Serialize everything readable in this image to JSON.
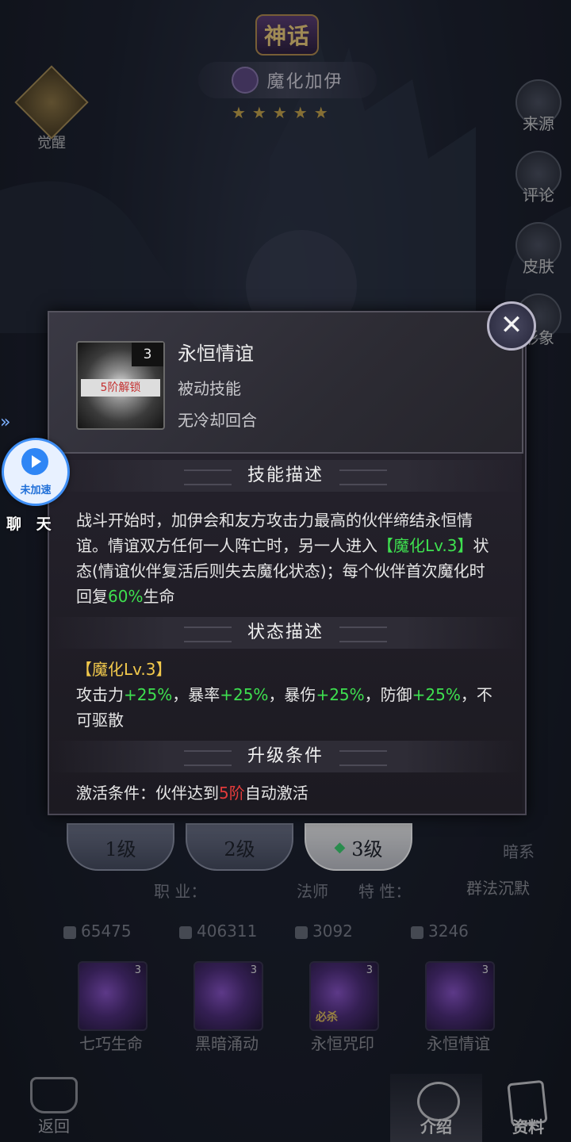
{
  "header": {
    "rarity_label": "神话",
    "hero_name": "魔化加伊",
    "stars": "★★★★★",
    "awaken_label": "觉醒"
  },
  "side_menu": [
    {
      "label": "来源"
    },
    {
      "label": "评论"
    },
    {
      "label": "皮肤"
    },
    {
      "label": "形象"
    }
  ],
  "speed_widget": {
    "label": "未加速",
    "chat_label": "聊 天"
  },
  "modal": {
    "skill_level": "3",
    "unlock_label": "5阶解锁",
    "skill_name": "永恒情谊",
    "skill_type": "被动技能",
    "cooldown": "无冷却回合",
    "close_symbol": "✕",
    "sections": {
      "skill_desc_title": "技能描述",
      "state_desc_title": "状态描述",
      "upgrade_title": "升级条件"
    },
    "skill_desc": {
      "p1": "战斗开始时，加伊会和友方攻击力最高的伙伴缔结永恒情谊。情谊双方任何一人阵亡时，另一人进入",
      "tag": "【魔化Lv.3】",
      "p2": "状态(情谊伙伴复活后则失去魔化状态)；每个伙伴首次魔化时回复",
      "pct": "60%",
      "p3": "生命"
    },
    "state_desc": {
      "tag": "【魔化Lv.3】",
      "atk_label": "攻击力",
      "atk_val": "+25%",
      "crit_label": "，暴率",
      "crit_val": "+25%",
      "critdmg_label": "，暴伤",
      "critdmg_val": "+25%",
      "def_label": "，防御",
      "def_val": "+25%",
      "tail": "，不可驱散"
    },
    "upgrade": {
      "prefix": "激活条件：伙伴达到",
      "rank": "5阶",
      "suffix": "自动激活"
    }
  },
  "level_tabs": [
    {
      "label": "1级"
    },
    {
      "label": "2级"
    },
    {
      "label": "3级"
    }
  ],
  "info": {
    "faction": "暗系",
    "job_label": "职  业：",
    "job_value": "法师",
    "trait_label": "特  性：",
    "trait_value": "群法沉默"
  },
  "stats": {
    "attack": "65475",
    "hp": "406311",
    "defense": "3092",
    "speed": "3246"
  },
  "skills": [
    {
      "name": "七巧生命",
      "level": "3"
    },
    {
      "name": "黑暗涌动",
      "level": "3"
    },
    {
      "name": "永恒咒印",
      "level": "3",
      "badge": "必杀"
    },
    {
      "name": "永恒情谊",
      "level": "3"
    }
  ],
  "bottom_nav": {
    "back": "返回",
    "intro": "介绍",
    "data": "资料"
  }
}
